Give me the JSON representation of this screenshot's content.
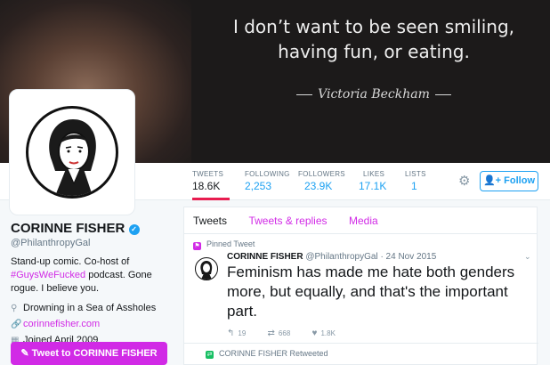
{
  "header": {
    "quote_line1": "I don’t want to be seen smiling,",
    "quote_line2": "having fun, or eating.",
    "signature": "Victoria Beckham"
  },
  "nav": {
    "stats": [
      {
        "label": "TWEETS",
        "value": "18.6K"
      },
      {
        "label": "FOLLOWING",
        "value": "2,253"
      },
      {
        "label": "FOLLOWERS",
        "value": "23.9K"
      },
      {
        "label": "LIKES",
        "value": "17.1K"
      },
      {
        "label": "LISTS",
        "value": "1"
      }
    ],
    "follow_label": "Follow"
  },
  "profile": {
    "name": "CORINNE FISHER",
    "handle": "@PhilanthropyGal",
    "bio_pre": "Stand-up comic. Co-host of",
    "bio_hashtag": "#GuysWeFucked",
    "bio_post": " podcast. Gone rogue. I believe you.",
    "location": "Drowning in a Sea of Assholes",
    "website": "corinnefisher.com",
    "joined": "Joined April 2009",
    "tweet_to_label": "Tweet to CORINNE FISHER"
  },
  "timeline": {
    "tabs": [
      "Tweets",
      "Tweets & replies",
      "Media"
    ],
    "pinned_label": "Pinned Tweet",
    "tweet": {
      "name": "CORINNE FISHER",
      "handle": "@PhilanthropyGal",
      "date": "· 24 Nov 2015",
      "text": "Feminism has made me hate both genders more, but equally, and that's the important part.",
      "replies": "19",
      "retweets": "668",
      "likes": "1.8K"
    },
    "retweeted_label": "CORINNE FISHER Retweeted"
  },
  "colors": {
    "accent": "#d12ae6",
    "link_blue": "#1da1f2"
  }
}
